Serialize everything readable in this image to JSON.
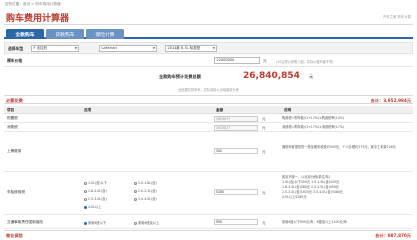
{
  "breadcrumb": "您的位置：首页 > 购车费用计算器",
  "page_title": "购车费用计算器",
  "top_right_link": "汽车之家 购车计算",
  "tabs": [
    {
      "label": "全款购车",
      "active": true
    },
    {
      "label": "贷款购车",
      "active": false
    },
    {
      "label": "保险计算",
      "active": false
    }
  ],
  "model_select": {
    "label": "选择车型",
    "brand": "F 法拉利",
    "series": "LaFerrari",
    "spec": "2014款 6.3L 标准型"
  },
  "price": {
    "label": "裸车价格",
    "value": "22000000",
    "unit": "元",
    "note": "(4S店报价参照入图，实际价格可能不同)"
  },
  "total": {
    "label": "全款购车预计花费总额",
    "value": "26,840,854",
    "unit": "元"
  },
  "disclaimer": "此结果仅供参考，实际费用以当地缴费为准",
  "required": {
    "label": "必要花费",
    "sum_label": "合计：",
    "sum_value": "3,952,984元"
  },
  "columns": {
    "item": "项目",
    "option": "选项",
    "amount": "金额",
    "desc": "说明"
  },
  "rows": {
    "purchase_tax": {
      "label": "购置税",
      "amount": "1923077",
      "unit": "元",
      "desc": "购置税=购车款/(1+17%)×购置税率(10%)"
    },
    "consumption_tax": {
      "label": "消费税",
      "amount": "1923077",
      "unit": "元",
      "desc": "消费税=购车款/(1+17%)×消费税率(17%)"
    },
    "plate_fee": {
      "label": "上牌费用",
      "amount": "500",
      "unit": "元",
      "desc": "通常商家提供的一条龙服务收费约500元，个人办理约373元，其中工本费128元"
    },
    "vehicle_tax": {
      "label": "车船使用税",
      "amount": "5280",
      "unit": "元",
      "options": [
        "1.0L(含)以下",
        "1.0-1.6L(含)",
        "1.6-2.0L(含)",
        "2.0-2.5L(含)",
        "2.5-3.0L(含)",
        "3.0-4.0L(含)",
        "4.0L以上"
      ],
      "selected": "4.0L以上",
      "desc_lines": [
        "各省不统一，以北京为例(单位/年)",
        "1.0L(含)以下300元  1.0-1.6L(含)420元",
        "1.6-2.0L(含)480元  2.0-2.5L(含)900元",
        "2.5-3.0L(含)1920元  3.0-4.0L(含)3480元",
        "4.0L以上5280元"
      ]
    },
    "compulsory_insurance": {
      "label": "交通事故责任强制保险",
      "options": [
        "家用6座以下",
        "家用6座及以上"
      ],
      "selected": "家用6座以下",
      "amount": "950",
      "unit": "元",
      "desc": "家用6座以下950元/年，6座及以上1100元/年"
    }
  },
  "commercial": {
    "label": "商业保险",
    "sum_label": "合计：",
    "sum_value": "887,870元"
  },
  "colors": {
    "brand_red": "#c0392b",
    "tab_blue": "#2a66a8"
  }
}
